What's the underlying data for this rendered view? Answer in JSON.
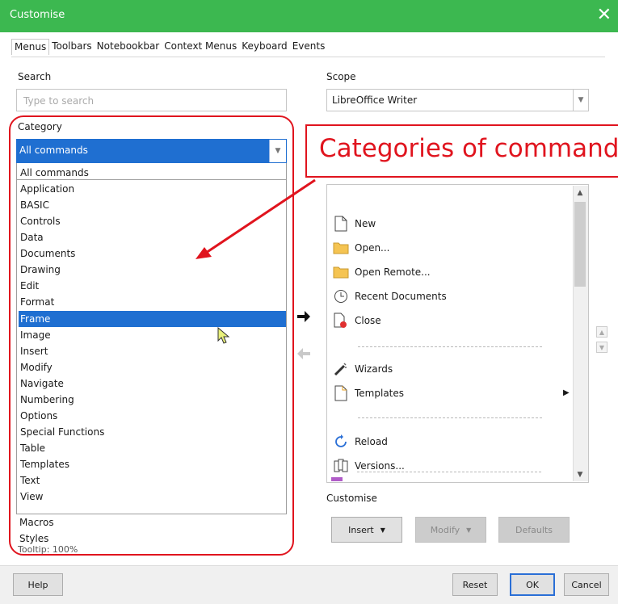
{
  "window": {
    "title": "Customise",
    "close_glyph": "✕"
  },
  "tabs": [
    "Menus",
    "Toolbars",
    "Notebookbar",
    "Context Menus",
    "Keyboard",
    "Events"
  ],
  "search": {
    "label": "Search",
    "placeholder": "Type to search"
  },
  "scope": {
    "label": "Scope",
    "value": "LibreOffice Writer"
  },
  "category": {
    "label": "Category",
    "selected": "All commands",
    "options": [
      "All commands",
      "Application",
      "BASIC",
      "Controls",
      "Data",
      "Documents",
      "Drawing",
      "Edit",
      "Format",
      "Frame",
      "Image",
      "Insert",
      "Modify",
      "Navigate",
      "Numbering",
      "Options",
      "Special Functions",
      "Table",
      "Templates",
      "Text",
      "View"
    ],
    "highlighted": "Frame",
    "extra_options": [
      "Macros",
      "Styles"
    ],
    "tooltip_text": "Tooltip: 100%"
  },
  "annotation": {
    "text": "Categories of commands",
    "color": "#e0141e"
  },
  "target_entries": [
    {
      "label": "New",
      "icon": "new-document-icon"
    },
    {
      "label": "Open...",
      "icon": "folder-open-icon"
    },
    {
      "label": "Open Remote...",
      "icon": "folder-remote-icon"
    },
    {
      "label": "Recent Documents",
      "icon": "clock-icon"
    },
    {
      "label": "Close",
      "icon": "close-document-icon"
    },
    {
      "label": "Wizards",
      "icon": "wand-icon"
    },
    {
      "label": "Templates",
      "icon": "template-icon"
    },
    {
      "label": "Reload",
      "icon": "reload-icon"
    },
    {
      "label": "Versions...",
      "icon": "versions-icon"
    }
  ],
  "customise": {
    "label": "Customise",
    "insert": "Insert",
    "modify": "Modify",
    "defaults": "Defaults"
  },
  "footer": {
    "help": "Help",
    "reset": "Reset",
    "ok": "OK",
    "cancel": "Cancel"
  },
  "colors": {
    "titlebar": "#3cb850",
    "selection": "#1f6fd1",
    "annotation": "#e0141e"
  }
}
